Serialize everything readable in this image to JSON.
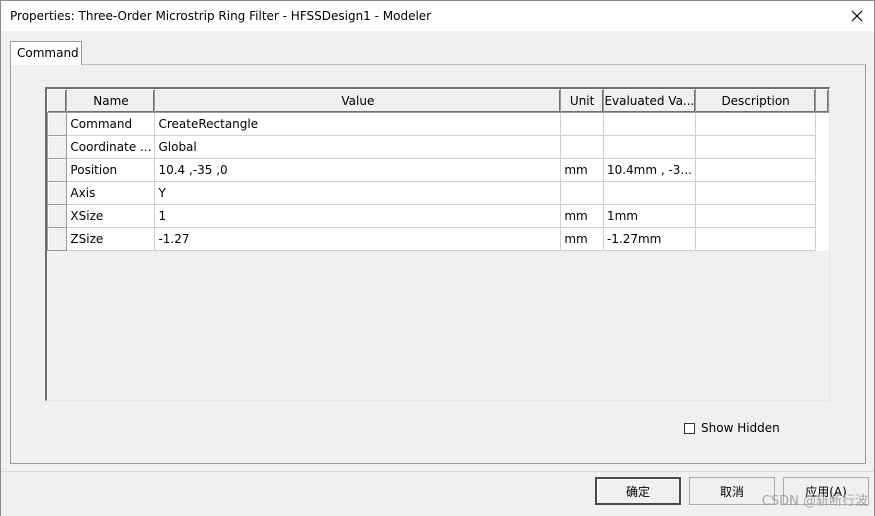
{
  "window": {
    "title": "Properties: Three-Order Microstrip Ring Filter - HFSSDesign1 - Modeler",
    "close_icon": "close-icon"
  },
  "tabs": [
    {
      "label": "Command",
      "active": true
    }
  ],
  "grid": {
    "columns": [
      "Name",
      "Value",
      "Unit",
      "Evaluated Va...",
      "Description"
    ],
    "rows": [
      {
        "name": "Command",
        "value": "CreateRectangle",
        "unit": "",
        "evaluated": "",
        "description": ""
      },
      {
        "name": "Coordinate ...",
        "value": "Global",
        "unit": "",
        "evaluated": "",
        "description": ""
      },
      {
        "name": "Position",
        "value": "10.4 ,-35 ,0",
        "unit": "mm",
        "evaluated": "10.4mm , -3...",
        "description": ""
      },
      {
        "name": "Axis",
        "value": "Y",
        "unit": "",
        "evaluated": "",
        "description": ""
      },
      {
        "name": "XSize",
        "value": "1",
        "unit": "mm",
        "evaluated": "1mm",
        "description": ""
      },
      {
        "name": "ZSize",
        "value": "-1.27",
        "unit": "mm",
        "evaluated": "-1.27mm",
        "description": ""
      }
    ]
  },
  "options": {
    "show_hidden_label": "Show Hidden",
    "show_hidden_checked": false
  },
  "buttons": {
    "ok": "确定",
    "cancel": "取消",
    "apply": "应用(A)"
  },
  "watermark": "CSDN @斩断行波"
}
